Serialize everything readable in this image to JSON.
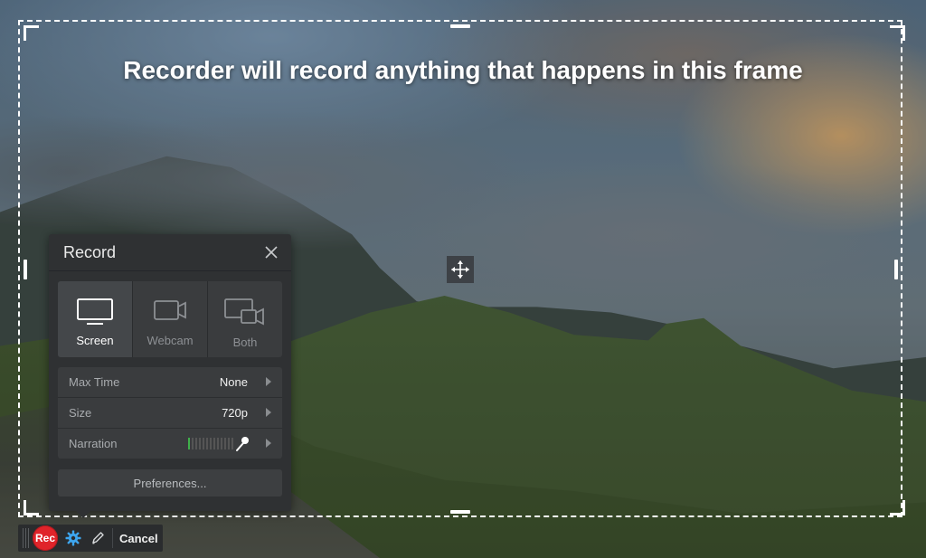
{
  "frame": {
    "headline": "Recorder will record anything that happens in this frame"
  },
  "panel": {
    "title": "Record",
    "modes": [
      {
        "label": "Screen",
        "icon": "monitor-icon",
        "active": true
      },
      {
        "label": "Webcam",
        "icon": "webcam-icon",
        "active": false
      },
      {
        "label": "Both",
        "icon": "screen-and-webcam-icon",
        "active": false
      }
    ],
    "settings": [
      {
        "label": "Max Time",
        "value": "None"
      },
      {
        "label": "Size",
        "value": "720p"
      },
      {
        "label": "Narration",
        "value": ""
      }
    ],
    "preferences_label": "Preferences..."
  },
  "toolbar": {
    "rec_label": "Rec",
    "cancel_label": "Cancel"
  },
  "colors": {
    "rec_red": "#e0242a",
    "meter_green": "#3fb04a",
    "panel_bg": "#2f3133"
  }
}
